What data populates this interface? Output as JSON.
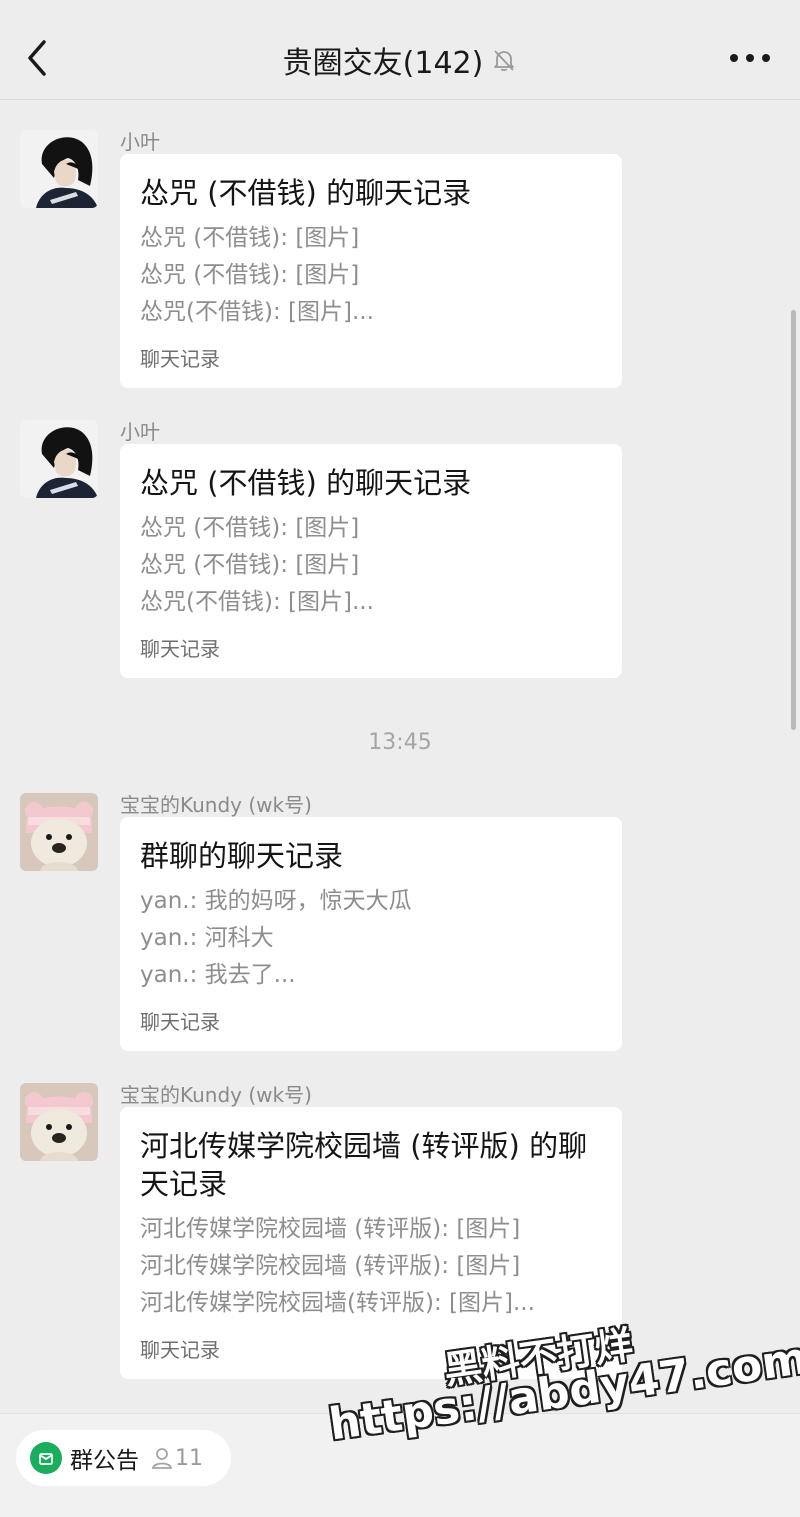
{
  "header": {
    "title": "贵圈交友(142)",
    "back_icon": "chevron-left-icon",
    "mute_icon": "bell-off-icon",
    "more_icon": "more-dots-icon"
  },
  "messages": [
    {
      "sender": "小叶",
      "avatar": "anime-boy-avatar",
      "card": {
        "title": "怂咒 (不借钱) 的聊天记录",
        "lines": [
          "怂咒 (不借钱): [图片]",
          "怂咒 (不借钱): [图片]",
          "怂咒(不借钱): [图片]..."
        ],
        "footer": "聊天记录"
      }
    },
    {
      "sender": "小叶",
      "avatar": "anime-boy-avatar",
      "card": {
        "title": "怂咒 (不借钱) 的聊天记录",
        "lines": [
          "怂咒 (不借钱): [图片]",
          "怂咒 (不借钱): [图片]",
          "怂咒(不借钱): [图片]..."
        ],
        "footer": "聊天记录"
      }
    },
    {
      "sender": "宝宝的Kundy (wk号)",
      "avatar": "teddy-bear-avatar",
      "card": {
        "title": "群聊的聊天记录",
        "lines": [
          "yan.: 我的妈呀，惊天大瓜",
          "yan.: 河科大",
          "yan.: 我去了..."
        ],
        "footer": "聊天记录"
      }
    },
    {
      "sender": "宝宝的Kundy (wk号)",
      "avatar": "teddy-bear-avatar",
      "card": {
        "title": "河北传媒学院校园墙 (转评版) 的聊天记录",
        "lines": [
          "河北传媒学院校园墙 (转评版): [图片]",
          "河北传媒学院校园墙 (转评版): [图片]",
          "河北传媒学院校园墙(转评版): [图片]..."
        ],
        "footer": "聊天记录"
      }
    }
  ],
  "timestamp": "13:45",
  "bottom": {
    "notice_label": "群公告",
    "member_count": "11"
  },
  "watermark": {
    "line1": "黑料不打烊",
    "line2": "https://abdy47.com"
  },
  "colors": {
    "background": "#ededed",
    "card": "#ffffff",
    "accent_green": "#1aad5c",
    "secondary_text": "#8e8e8e"
  }
}
